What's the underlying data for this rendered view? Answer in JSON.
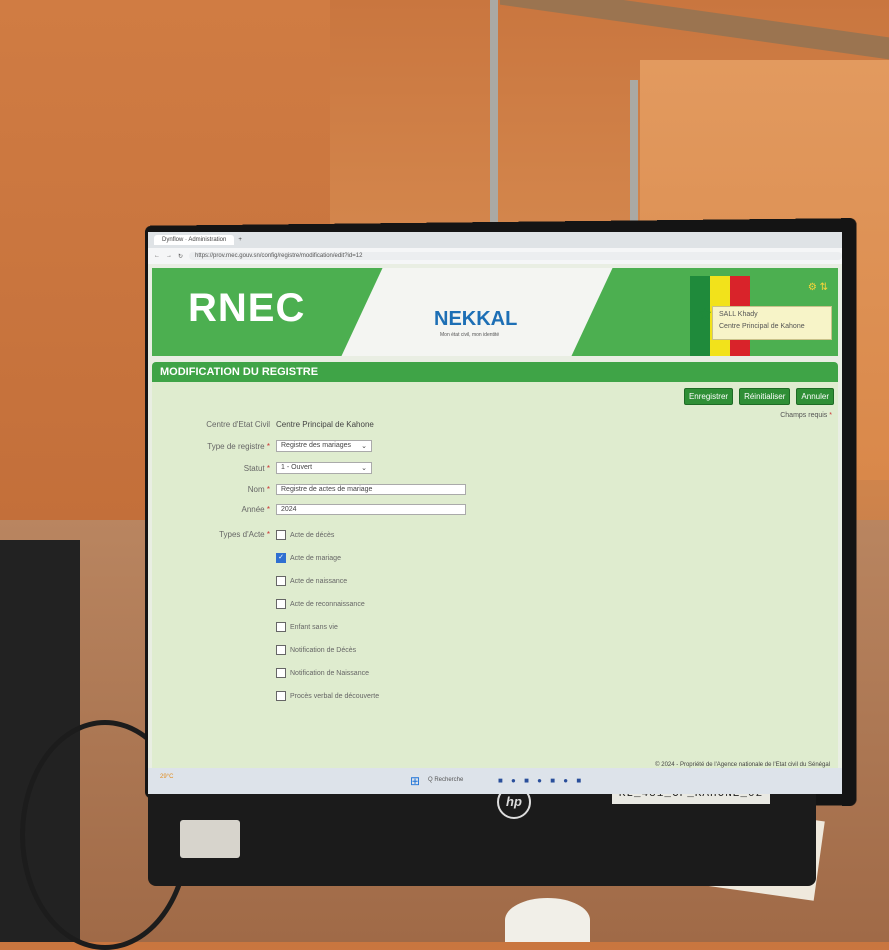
{
  "browser": {
    "tab_label": "Dynflow · Administration",
    "url": "https://prov.rnec.gouv.sn/config/registre/modification/edit?id=12"
  },
  "app": {
    "brand": "RNEC",
    "nekkal": "NEKKAL",
    "nekkal_tagline": "Mon état civil, mon identité",
    "user_name": "SALL Khady",
    "user_center": "Centre Principal de Kahone"
  },
  "page": {
    "title": "MODIFICATION DU REGISTRE",
    "buttons": {
      "save": "Enregistrer",
      "reset": "Réinitialiser",
      "cancel": "Annuler"
    },
    "required_note": "Champs requis",
    "fields": {
      "centre_label": "Centre d'Etat Civil",
      "centre_value": "Centre Principal de Kahone",
      "type_label": "Type de registre",
      "type_value": "Registre des mariages",
      "statut_label": "Statut",
      "statut_value": "1 - Ouvert",
      "nom_label": "Nom",
      "nom_value": "Registre de actes de mariage",
      "annee_label": "Année",
      "annee_value": "2024",
      "types_label": "Types d'Acte"
    },
    "types": [
      {
        "label": "Acte de décès",
        "checked": false
      },
      {
        "label": "Acte de mariage",
        "checked": true
      },
      {
        "label": "Acte de naissance",
        "checked": false
      },
      {
        "label": "Acte de reconnaissance",
        "checked": false
      },
      {
        "label": "Enfant sans vie",
        "checked": false
      },
      {
        "label": "Notification de Décès",
        "checked": false
      },
      {
        "label": "Notification de Naissance",
        "checked": false
      },
      {
        "label": "Procès verbal de découverte",
        "checked": false
      }
    ],
    "footer": "© 2024 - Propriété de l'Agence nationale de l'Etat civil du Sénégal"
  },
  "taskbar": {
    "search": "Q Recherche",
    "weather": "29°C"
  },
  "hardware": {
    "asset_tag": "KL_481_CP_KAHONE_02",
    "hp": "hp"
  },
  "colors": {
    "green": "#4caf50",
    "dark_green": "#2f8f36",
    "flag_green": "#1f8a3b",
    "flag_yellow": "#f2e21b",
    "flag_red": "#d9232a"
  }
}
